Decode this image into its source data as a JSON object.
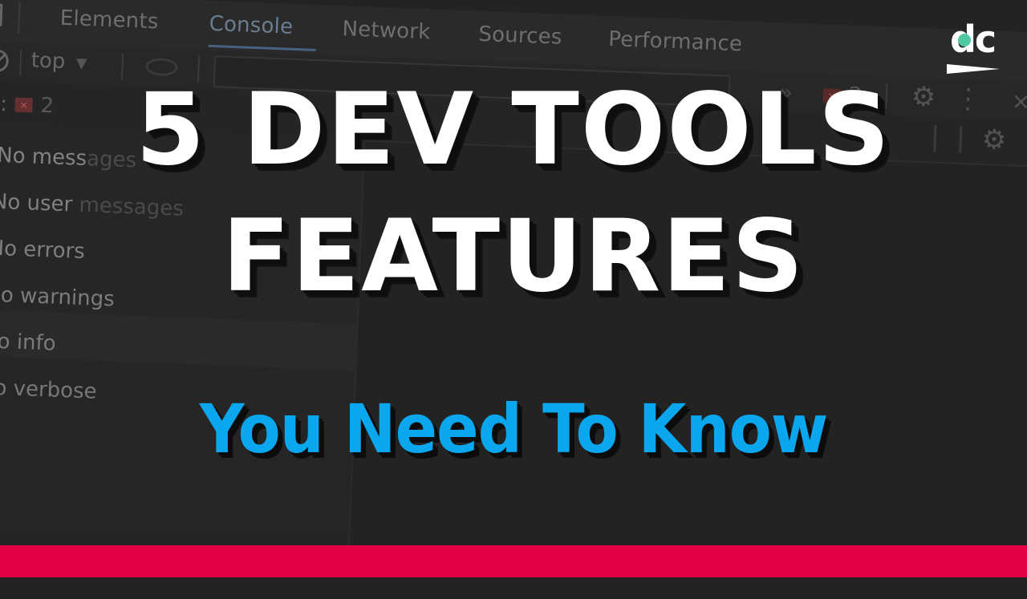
{
  "devtools": {
    "tabs": [
      {
        "label": "Elements",
        "active": false
      },
      {
        "label": "Console",
        "active": true
      },
      {
        "label": "Network",
        "active": false
      },
      {
        "label": "Sources",
        "active": false
      },
      {
        "label": "Performance",
        "active": false
      }
    ],
    "more_tabs_glyph": "»",
    "error_badge_glyph": "×",
    "error_count": "2",
    "settings_icon": "gear-icon",
    "menu_icon": "kebab-icon",
    "close_glyph": "×",
    "toolbar": {
      "context_value": "top",
      "context_arrow": "▼"
    },
    "issues": {
      "label": "es:",
      "badge_glyph": "×",
      "count": "2"
    },
    "sidebar": {
      "items": [
        {
          "label_main": "No mess",
          "label_fade": "ages"
        },
        {
          "label_main": "No user ",
          "label_fade": "messages"
        },
        {
          "label_main": "No errors",
          "label_fade": ""
        },
        {
          "label_main": "No warnings",
          "label_fade": ""
        },
        {
          "label_main": "No info",
          "label_fade": ""
        },
        {
          "label_main": "No verbose",
          "label_fade": ""
        }
      ]
    }
  },
  "thumbnail": {
    "title_line_1": "5 DEV TOOLS",
    "title_line_2": "FEATURES",
    "subtitle": "You Need To Know",
    "logo_text": "dc"
  },
  "colors": {
    "background": "#232323",
    "title": "#ffffff",
    "subtitle": "#0aa7ee",
    "logo_accent": "#4fc9a4",
    "brand_bar": "#e30045"
  }
}
